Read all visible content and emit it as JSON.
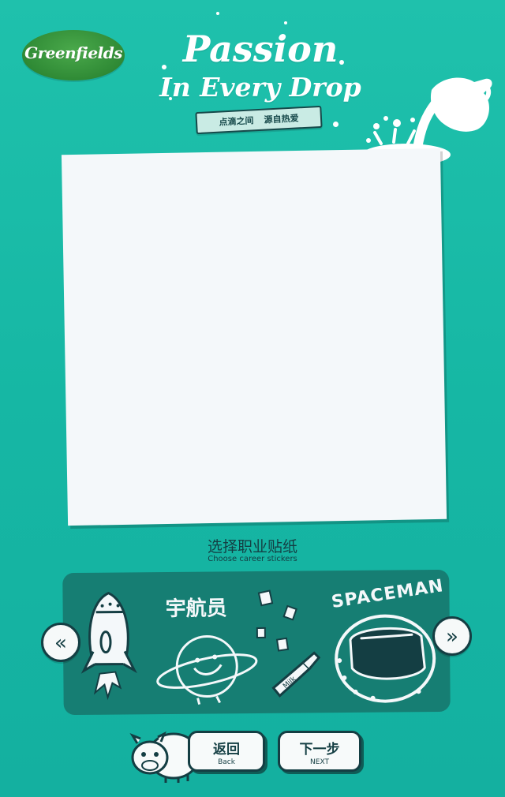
{
  "brand": {
    "logo_text": "Greenfields"
  },
  "headline": {
    "line1": "Passion",
    "line2": "In Every Drop"
  },
  "ribbon": {
    "left": "点滴之间",
    "right": "源自热爱"
  },
  "section": {
    "title": "选择职业贴纸",
    "subtitle": "Choose career stickers"
  },
  "stickers": {
    "label_zh": "宇航员",
    "label_en": "SPACEMAN",
    "bottle_text": "Milk"
  },
  "nav": {
    "prev": "«",
    "next": "»"
  },
  "buttons": {
    "back": {
      "zh": "返回",
      "en": "Back"
    },
    "next": {
      "zh": "下一步",
      "en": "NEXT"
    }
  },
  "colors": {
    "background": "#17b9a6",
    "panel": "#167e73",
    "outline": "#143e43",
    "frame": "#f4f8fa"
  }
}
